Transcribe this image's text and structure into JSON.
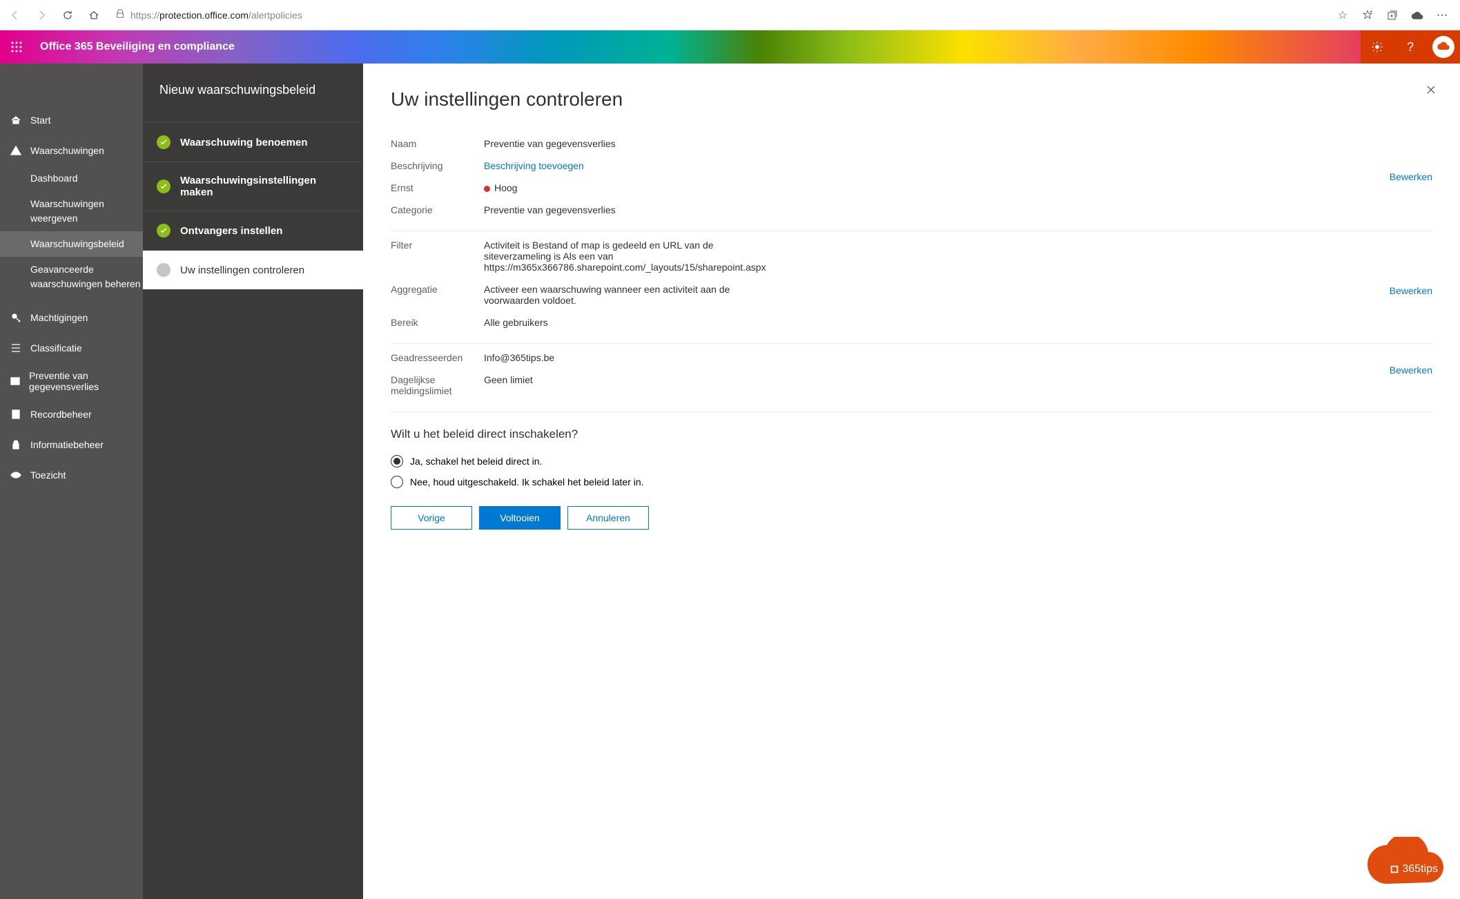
{
  "browser": {
    "url_proto": "https://",
    "url_host": "protection.office.com",
    "url_path": "/alertpolicies"
  },
  "suite": {
    "title": "Office 365 Beveiliging en compliance"
  },
  "leftnav": {
    "start": "Start",
    "alerts": "Waarschuwingen",
    "sub_dashboard": "Dashboard",
    "sub_view": "Waarschuwingen weergeven",
    "sub_policies": "Waarschuwingsbeleid",
    "sub_advanced": "Geavanceerde waarschuwingen beheren",
    "permissions": "Machtigingen",
    "classification": "Classificatie",
    "dlp": "Preventie van gegevensverlies",
    "records": "Recordbeheer",
    "infogov": "Informatiebeheer",
    "supervision": "Toezicht"
  },
  "wizard": {
    "title": "Nieuw waarschuwingsbeleid",
    "step1": "Waarschuwing benoemen",
    "step2": "Waarschuwingsinstellingen maken",
    "step3": "Ontvangers instellen",
    "step4": "Uw instellingen controleren"
  },
  "panel": {
    "heading": "Uw instellingen controleren",
    "labels": {
      "name": "Naam",
      "description": "Beschrijving",
      "severity": "Ernst",
      "category": "Categorie",
      "filter": "Filter",
      "aggregation": "Aggregatie",
      "scope": "Bereik",
      "recipients": "Geadresseerden",
      "daily_limit": "Dagelijkse meldingslimiet"
    },
    "values": {
      "name": "Preventie van gegevensverlies",
      "description_link": "Beschrijving toevoegen",
      "severity": "Hoog",
      "category": "Preventie van gegevensverlies",
      "filter": "Activiteit is Bestand of map is gedeeld en URL van de siteverzameling is Als een van https://m365x366786.sharepoint.com/_layouts/15/sharepoint.aspx",
      "aggregation": "Activeer een waarschuwing wanneer een activiteit aan de voorwaarden voldoet.",
      "scope": "Alle gebruikers",
      "recipients": "Info@365tips.be",
      "daily_limit": "Geen limiet"
    },
    "edit": "Bewerken",
    "enable_prompt": "Wilt u het beleid direct inschakelen?",
    "radio_yes": "Ja, schakel het beleid direct in.",
    "radio_no": "Nee, houd uitgeschakeld. Ik schakel het beleid later in.",
    "btn_back": "Vorige",
    "btn_finish": "Voltooien",
    "btn_cancel": "Annuleren"
  },
  "brand": {
    "label": "365tips"
  }
}
